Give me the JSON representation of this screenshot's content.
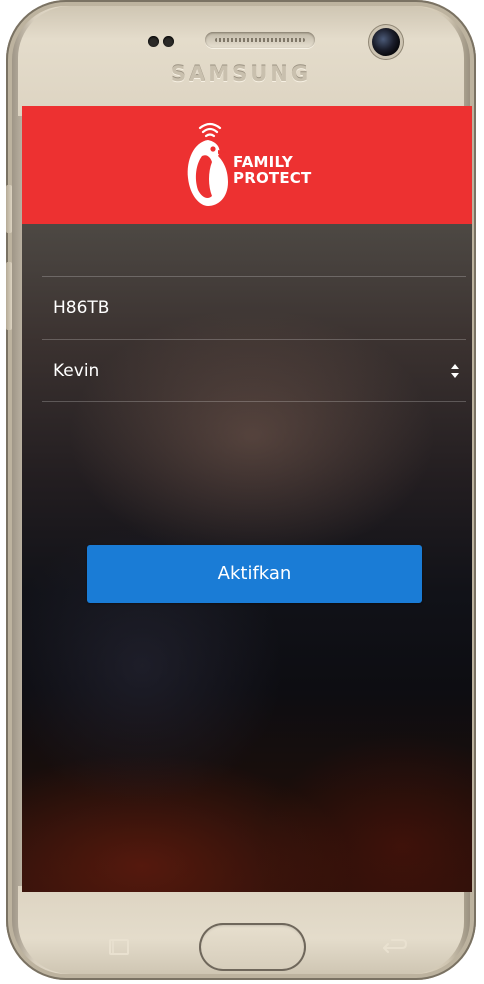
{
  "device": {
    "brand": "SAMSUNG"
  },
  "app": {
    "header_color": "#ed3131",
    "logo": {
      "line1": "FAMILY",
      "line2": "PROTECT"
    }
  },
  "form": {
    "code_value": "H86TB",
    "child_select_value": "Kevin"
  },
  "activate_button": {
    "label": "Aktifkan",
    "color": "#1a7cd6"
  },
  "icons": {
    "logo": "penguin-wifi-logo-icon",
    "select": "sort-arrows-icon",
    "recent_apps": "recent-apps-icon",
    "back": "back-icon"
  }
}
